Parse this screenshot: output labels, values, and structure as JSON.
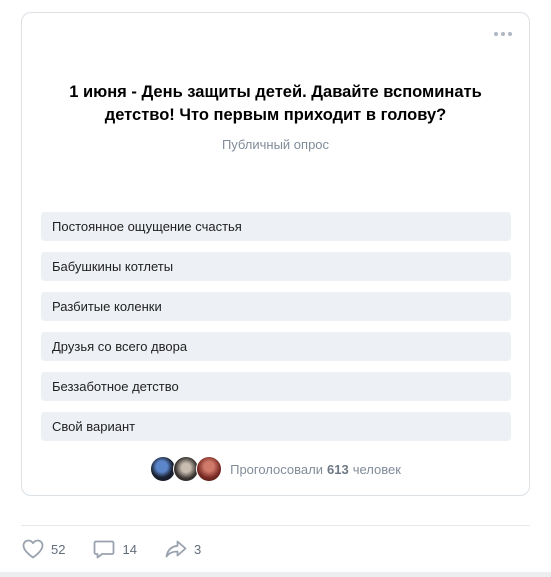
{
  "poll": {
    "title": "1 июня - День защиты детей. Давайте вспоминать детство! Что первым приходит в голову?",
    "subtitle": "Публичный опрос",
    "more_icon": "more-horizontal-icon",
    "options": [
      {
        "label": "Постоянное ощущение счастья"
      },
      {
        "label": "Бабушкины котлеты"
      },
      {
        "label": "Разбитые коленки"
      },
      {
        "label": "Друзья со всего двора"
      },
      {
        "label": "Беззаботное детство"
      },
      {
        "label": "Свой вариант"
      }
    ],
    "voters": {
      "prefix": "Проголосовали",
      "count": "613",
      "suffix": "человек"
    }
  },
  "actions": {
    "likes": {
      "icon": "heart-icon",
      "count": "52"
    },
    "comments": {
      "icon": "comment-icon",
      "count": "14"
    },
    "shares": {
      "icon": "share-icon",
      "count": "3"
    }
  },
  "colors": {
    "option_bg": "#edf0f4",
    "muted_text": "#818c99",
    "icon": "#99a2ad",
    "border": "#dce1e6"
  }
}
